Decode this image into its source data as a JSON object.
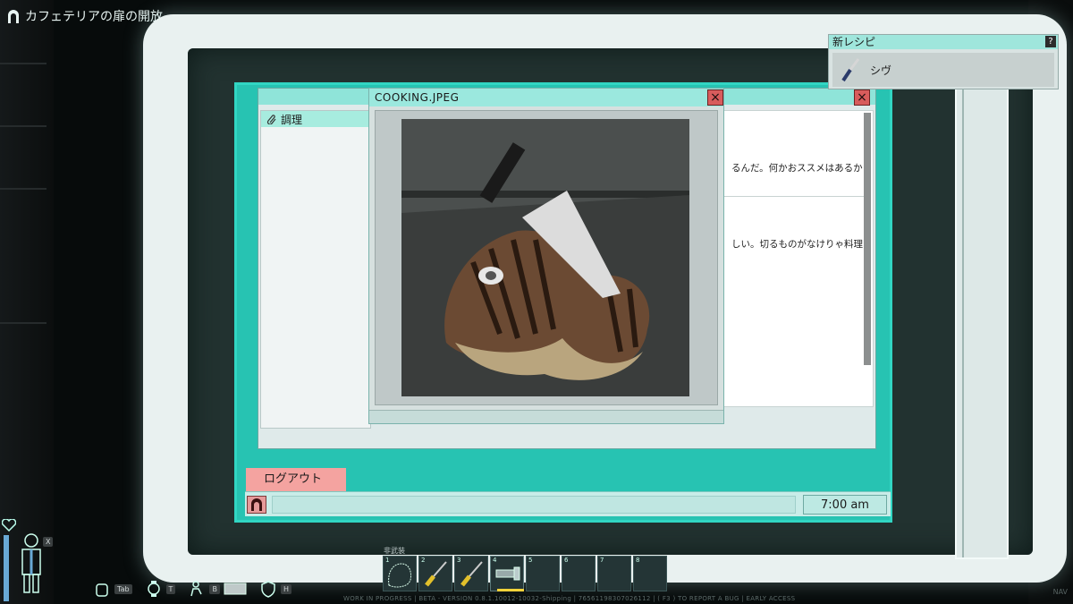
{
  "objective": {
    "text": "カフェテリアの扉の開放"
  },
  "recipe_popup": {
    "title": "新レシピ",
    "help": "?",
    "item_name": "シヴ"
  },
  "back_window": {
    "sidebar_item": "調理",
    "messages": [
      "るんだ。何かおススメはあるか",
      "しい。切るものがなけりゃ料理"
    ]
  },
  "front_window": {
    "title": "COOKING.JPEG"
  },
  "logout_label": "ログアウト",
  "clock": "7:00 am",
  "hud": {
    "close_key": "X",
    "keys": [
      "Tab",
      "T",
      "B",
      "H"
    ],
    "inventory_label": "非武装",
    "slot_numbers": [
      "1",
      "2",
      "3",
      "4",
      "5",
      "6",
      "7",
      "8"
    ]
  },
  "footer_text": "WORK IN PROGRESS | BETA - VERSION 0.8.1.10012-10032-Shipping | 76561198307026112 | ( F3 ) TO REPORT A BUG | EARLY ACCESS",
  "nav_text": "NAV",
  "colors": {
    "screen": "#27c3b2",
    "titlebar": "#9be8de",
    "logout": "#f4a3a0",
    "close": "#d85c5c"
  }
}
